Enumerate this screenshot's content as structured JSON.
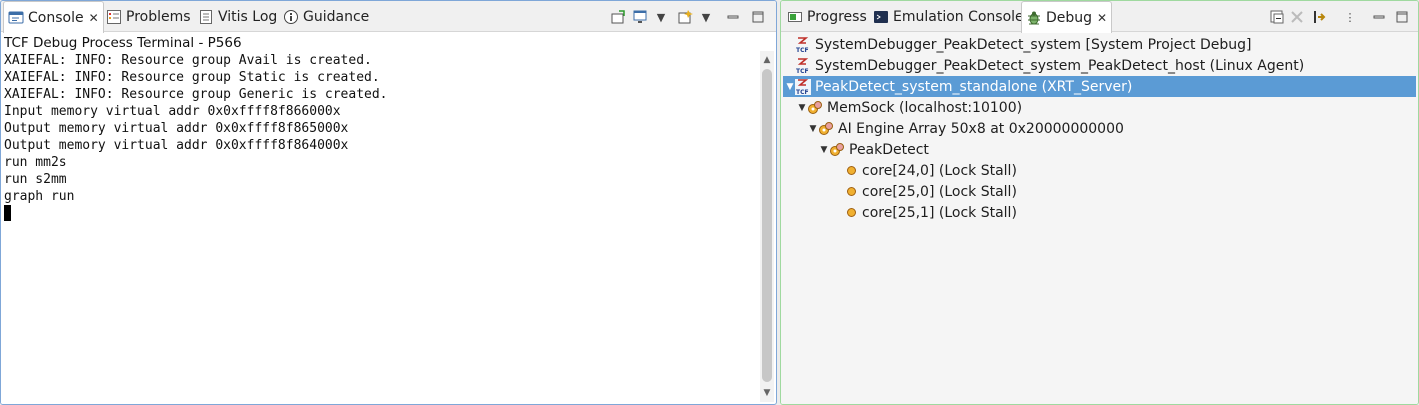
{
  "left_tabs": [
    {
      "label": "Console",
      "active": true,
      "icon": "console-icon"
    },
    {
      "label": "Problems",
      "active": false,
      "icon": "problems-icon"
    },
    {
      "label": "Vitis Log",
      "active": false,
      "icon": "log-icon"
    },
    {
      "label": "Guidance",
      "active": false,
      "icon": "info-icon"
    }
  ],
  "right_tabs": [
    {
      "label": "Progress",
      "active": false,
      "icon": "progress-icon"
    },
    {
      "label": "Emulation Console",
      "active": false,
      "icon": "terminal-icon"
    },
    {
      "label": "Debug",
      "active": true,
      "icon": "bug-icon"
    }
  ],
  "console": {
    "title": "TCF Debug Process Terminal - P566",
    "lines": [
      "XAIEFAL: INFO: Resource group Avail is created.",
      "XAIEFAL: INFO: Resource group Static is created.",
      "XAIEFAL: INFO: Resource group Generic is created.",
      "Input memory virtual addr 0x0xffff8f866000x",
      "Output memory virtual addr 0x0xffff8f865000x",
      "Output memory virtual addr 0x0xffff8f864000x",
      "run mm2s",
      "run s2mm",
      "graph run"
    ]
  },
  "debug_tree": [
    {
      "label": "SystemDebugger_PeakDetect_system [System Project Debug]",
      "icon": "tcf-icon",
      "twisty": ""
    },
    {
      "label": "SystemDebugger_PeakDetect_system_PeakDetect_host (Linux Agent)",
      "icon": "tcf-icon",
      "twisty": ""
    },
    {
      "label": "PeakDetect_system_standalone (XRT_Server)",
      "icon": "tcf-icon",
      "twisty": "▾",
      "selected": true
    },
    {
      "label": "MemSock (localhost:10100)",
      "icon": "process-icon",
      "twisty": "▾"
    },
    {
      "label": "AI Engine Array 50x8 at 0x20000000000",
      "icon": "process-icon",
      "twisty": "▾"
    },
    {
      "label": "PeakDetect",
      "icon": "process-icon",
      "twisty": "▾"
    },
    {
      "label": "core[24,0] (Lock Stall)",
      "icon": "thread-icon",
      "twisty": ""
    },
    {
      "label": "core[25,0] (Lock Stall)",
      "icon": "thread-icon",
      "twisty": ""
    },
    {
      "label": "core[25,1] (Lock Stall)",
      "icon": "thread-icon",
      "twisty": ""
    }
  ]
}
